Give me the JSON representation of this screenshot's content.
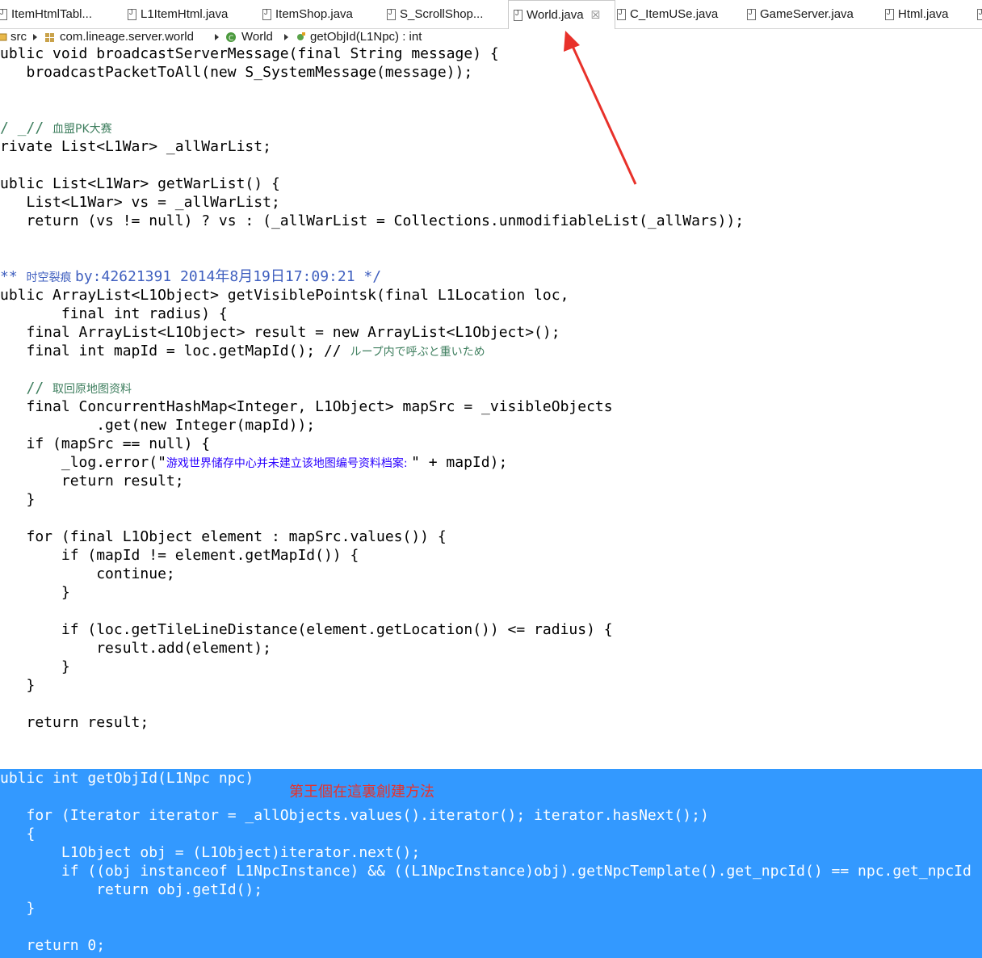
{
  "tabs": [
    {
      "label": "ItemHtmlTabl...",
      "active": false
    },
    {
      "label": "L1ItemHtml.java",
      "active": false
    },
    {
      "label": "ItemShop.java",
      "active": false
    },
    {
      "label": "S_ScrollShop...",
      "active": false
    },
    {
      "label": "World.java",
      "active": true
    },
    {
      "label": "C_ItemUSe.java",
      "active": false
    },
    {
      "label": "GameServer.java",
      "active": false
    },
    {
      "label": "Html.java",
      "active": false
    }
  ],
  "tab_close_glyph": "☒",
  "breadcrumb": [
    {
      "label": "src",
      "icon": "source-folder-icon"
    },
    {
      "label": "com.lineage.server.world",
      "icon": "package-icon"
    },
    {
      "label": "World",
      "icon": "class-icon"
    },
    {
      "label": "getObjId(L1Npc) : int",
      "icon": "method-icon"
    }
  ],
  "code": {
    "l01": "ublic void broadcastServerMessage(final String message) {",
    "l02": "   broadcastPacketToAll(new S_SystemMessage(message));",
    "l05a": "/ _// ",
    "l05b": "血盟PK大赛",
    "l06": "rivate List<L1War> _allWarList;",
    "l08": "ublic List<L1War> getWarList() {",
    "l09": "   List<L1War> vs = _allWarList;",
    "l10": "   return (vs != null) ? vs : (_allWarList = Collections.unmodifiableList(_allWars));",
    "l13a": "** ",
    "l13b": "时空裂痕 ",
    "l13c": "by:42621391 2014年8月19日17:09:21 */",
    "l14": "ublic ArrayList<L1Object> getVisiblePointsk(final L1Location loc,",
    "l15": "       final int radius) {",
    "l16": "   final ArrayList<L1Object> result = new ArrayList<L1Object>();",
    "l17a": "   final int mapId = loc.getMapId(); // ",
    "l17b": "ループ内で呼ぶと重いため",
    "l19a": "   // ",
    "l19b": "取回原地图资料",
    "l20": "   final ConcurrentHashMap<Integer, L1Object> mapSrc = _visibleObjects",
    "l21": "           .get(new Integer(mapId));",
    "l22": "   if (mapSrc == null) {",
    "l23a": "       _log.error(\"",
    "l23b": "游戏世界储存中心并未建立该地图编号资料档案: ",
    "l23c": "\" + mapId);",
    "l24": "       return result;",
    "l25": "   }",
    "l27": "   for (final L1Object element : mapSrc.values()) {",
    "l28": "       if (mapId != element.getMapId()) {",
    "l29": "           continue;",
    "l30": "       }",
    "l32": "       if (loc.getTileLineDistance(element.getLocation()) <= radius) {",
    "l33": "           result.add(element);",
    "l34": "       }",
    "l35": "   }",
    "l37": "   return result;",
    "l40": "ublic int getObjId(L1Npc npc)",
    "l42": "   for (Iterator iterator = _allObjects.values().iterator(); iterator.hasNext();)",
    "l43": "   {",
    "l44": "       L1Object obj = (L1Object)iterator.next();",
    "l45": "       if ((obj instanceof L1NpcInstance) && ((L1NpcInstance)obj).getNpcTemplate().get_npcId() == npc.get_npcId",
    "l46": "           return obj.getId();",
    "l47": "   }",
    "l49": "   return 0;"
  },
  "annotation": "第王個在這裏創建方法",
  "colors": {
    "selection": "#3399ff",
    "keyword": "#7f0055",
    "field": "#0000c0",
    "comment": "#3f7f5f",
    "string": "#2a00ff",
    "annotation": "#e8312a"
  }
}
